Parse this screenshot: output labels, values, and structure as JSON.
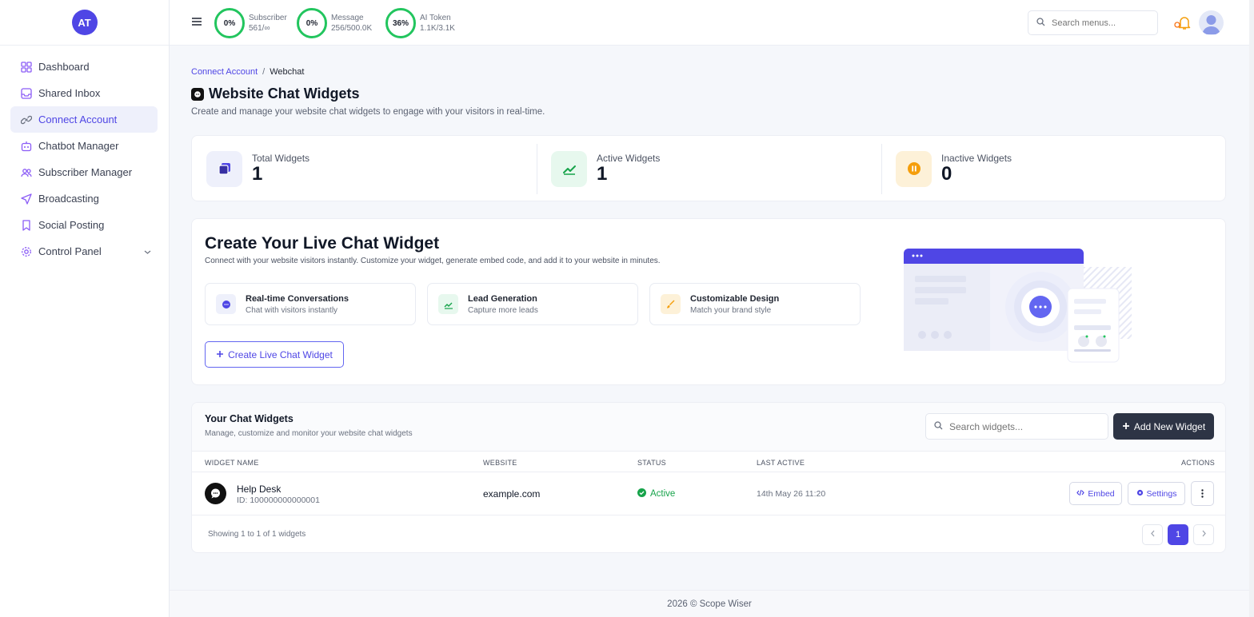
{
  "sidebar": {
    "avatar_initials": "AT",
    "items": [
      {
        "label": "Dashboard",
        "icon": "dashboard-icon"
      },
      {
        "label": "Shared Inbox",
        "icon": "inbox-icon"
      },
      {
        "label": "Connect Account",
        "icon": "link-icon",
        "active": true
      },
      {
        "label": "Chatbot Manager",
        "icon": "bot-icon"
      },
      {
        "label": "Subscriber Manager",
        "icon": "users-icon"
      },
      {
        "label": "Broadcasting",
        "icon": "send-icon"
      },
      {
        "label": "Social Posting",
        "icon": "bookmark-icon"
      },
      {
        "label": "Control Panel",
        "icon": "gear-icon"
      }
    ]
  },
  "topbar": {
    "stats": [
      {
        "percent": "0%",
        "label": "Subscriber",
        "value": "561/∞"
      },
      {
        "percent": "0%",
        "label": "Message",
        "value": "256/500.0K"
      },
      {
        "percent": "36%",
        "label": "AI Token",
        "value": "1.1K/3.1K"
      }
    ],
    "search_placeholder": "Search menus..."
  },
  "breadcrumb": {
    "parent": "Connect Account",
    "separator": "/",
    "current": "Webchat"
  },
  "page": {
    "title": "Website Chat Widgets",
    "subtitle": "Create and manage your website chat widgets to engage with your visitors in real-time."
  },
  "stats": [
    {
      "label": "Total Widgets",
      "value": "1",
      "color": "#4f46e5"
    },
    {
      "label": "Active Widgets",
      "value": "1",
      "color": "#16a34a"
    },
    {
      "label": "Inactive Widgets",
      "value": "0",
      "color": "#f59e0b"
    }
  ],
  "create": {
    "title": "Create Your Live Chat Widget",
    "subtitle": "Connect with your website visitors instantly. Customize your widget, generate embed code, and add it to your website in minutes.",
    "features": [
      {
        "title": "Real-time Conversations",
        "sub": "Chat with visitors instantly"
      },
      {
        "title": "Lead Generation",
        "sub": "Capture more leads"
      },
      {
        "title": "Customizable Design",
        "sub": "Match your brand style"
      }
    ],
    "button": "Create Live Chat Widget"
  },
  "widgets": {
    "title": "Your Chat Widgets",
    "subtitle": "Manage, customize and monitor your website chat widgets",
    "search_placeholder": "Search widgets...",
    "add_button": "Add New Widget",
    "columns": [
      "WIDGET NAME",
      "WEBSITE",
      "STATUS",
      "LAST ACTIVE",
      "ACTIONS"
    ],
    "rows": [
      {
        "name": "Help Desk",
        "id": "ID: 100000000000001",
        "website": "example.com",
        "status": "Active",
        "last_active": "14th May 26 11:20"
      }
    ],
    "embed_label": "Embed",
    "settings_label": "Settings",
    "showing": "Showing 1 to 1 of 1 widgets",
    "page": "1"
  },
  "footer": "2026 © Scope Wiser",
  "colors": {
    "accent": "#4f46e5",
    "success": "#22c55e",
    "warning": "#f59e0b",
    "dark_button": "#2d3445"
  }
}
